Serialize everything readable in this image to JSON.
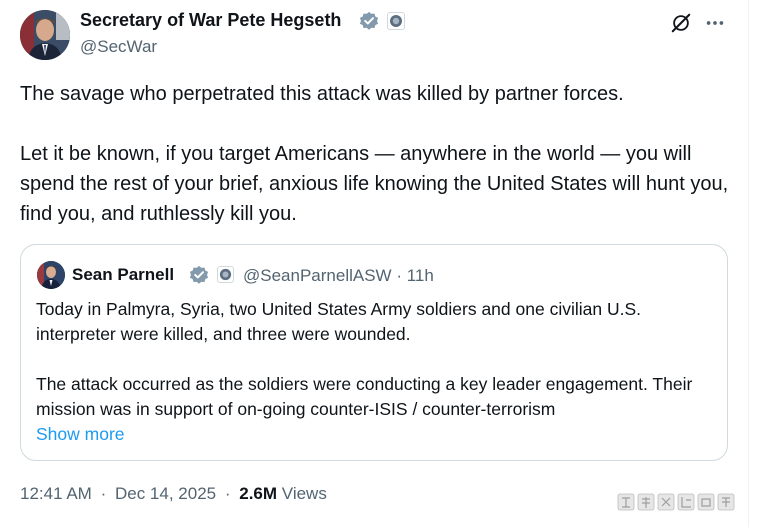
{
  "tweet": {
    "author": {
      "name": "Secretary of War Pete Hegseth",
      "handle": "@SecWar"
    },
    "paragraphs": [
      "The savage who perpetrated this attack was killed by partner forces.",
      "Let it be known, if you target Americans — anywhere in the world — you will spend the rest of your brief, anxious life knowing the United States will hunt you, find you, and ruthlessly kill you."
    ],
    "quote": {
      "author_name": "Sean Parnell",
      "handle_time": "@SeanParnellASW · 11h",
      "paragraphs": [
        "Today in Palmyra, Syria, two United States Army soldiers and one civilian U.S. interpreter were killed, and three were wounded.",
        "The attack occurred as the soldiers were conducting a key leader engagement. Their mission was in support of on-going counter-ISIS / counter-terrorism"
      ],
      "show_more": "Show more"
    },
    "meta": {
      "time": "12:41 AM",
      "separator": "·",
      "date": "Dec 14, 2025",
      "views_count": "2.6M",
      "views_label": "Views"
    }
  },
  "icons": {
    "verified": "verified-badge-icon",
    "affiliation": "government-affiliation-icon",
    "grok": "grok-icon",
    "more": "more-options-icon"
  },
  "colors": {
    "text": "#0f1419",
    "secondary": "#536471",
    "link": "#1d9bf0",
    "verified_badge": "#829aab",
    "border": "#cfd9de"
  }
}
